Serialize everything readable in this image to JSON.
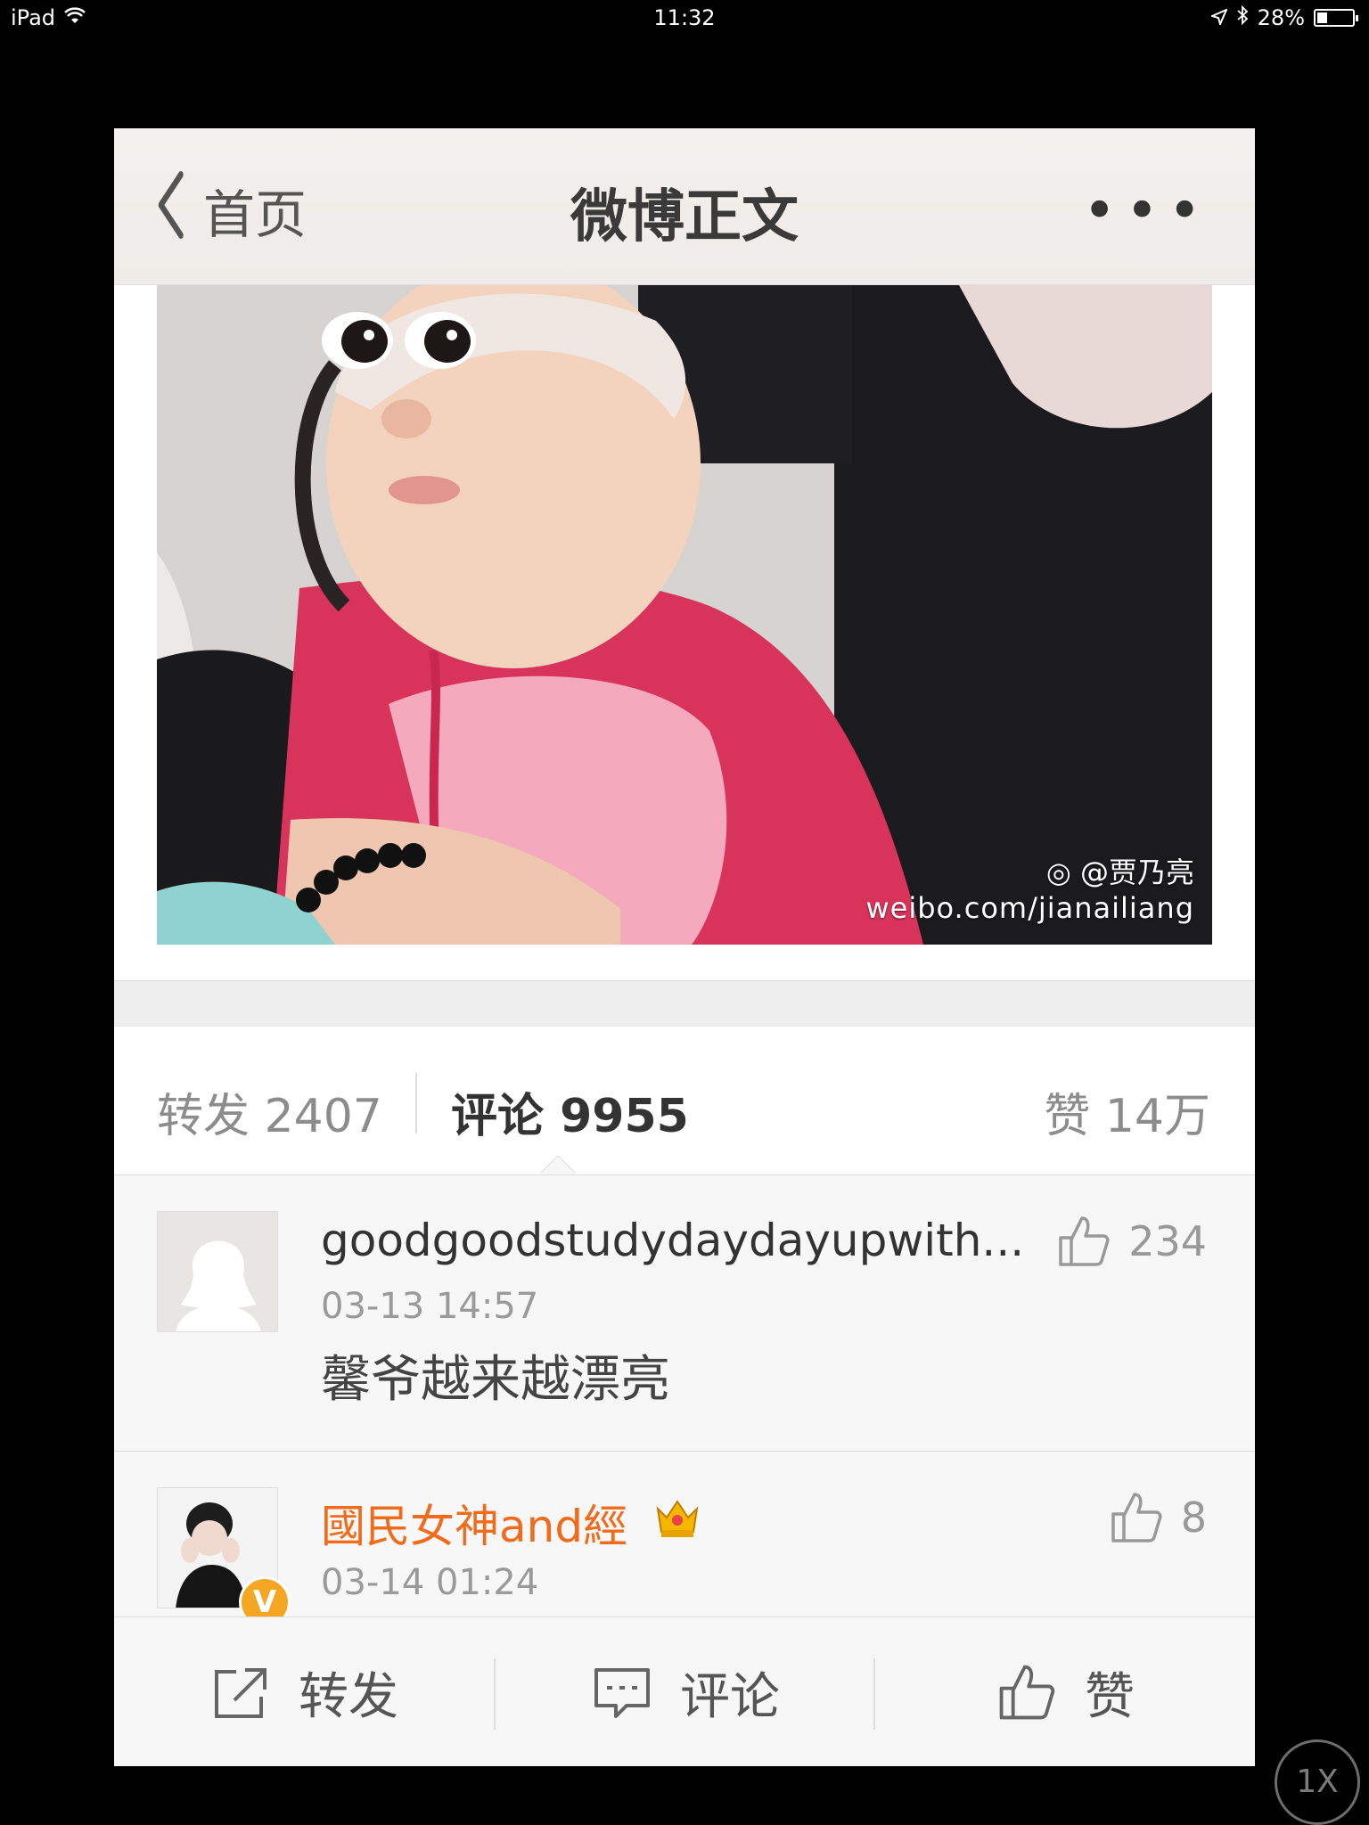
{
  "status_bar": {
    "device": "iPad",
    "time": "11:32",
    "battery": "28%",
    "battery_level": 0.28
  },
  "nav": {
    "back_label": "首页",
    "title": "微博正文",
    "more_label": "•••"
  },
  "photo": {
    "watermark_user": "@贾乃亮",
    "watermark_url": "weibo.com/jianailiang"
  },
  "stats": {
    "repost": "转发 2407",
    "comment": "评论 9955",
    "like": "赞 14万"
  },
  "comments": [
    {
      "name": "goodgoodstudydaydayupwith...",
      "time": "03-13 14:57",
      "text": "馨爷越来越漂亮",
      "likes": "234"
    },
    {
      "name": "國民女神and經",
      "time": "03-14 01:24",
      "likes": "8",
      "badge": "V"
    }
  ],
  "toolbar": {
    "repost_label": "转发",
    "comment_label": "评论",
    "like_label": "赞"
  },
  "speed_badge": "1X",
  "colors": {
    "accent_orange": "#f06c1c",
    "vip_badge": "#f5a623"
  }
}
